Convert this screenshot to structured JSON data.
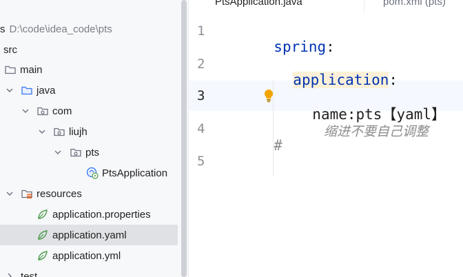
{
  "project_tree": {
    "root": {
      "name": "s",
      "path": "D:\\code\\idea_code\\pts"
    },
    "items": [
      {
        "label": "src"
      },
      {
        "label": "main"
      },
      {
        "label": "java"
      },
      {
        "label": "com"
      },
      {
        "label": "liujh"
      },
      {
        "label": "pts"
      },
      {
        "label": "PtsApplication"
      },
      {
        "label": "resources"
      },
      {
        "label": "application.properties"
      },
      {
        "label": "application.yaml"
      },
      {
        "label": "application.yml"
      },
      {
        "label": "test"
      }
    ]
  },
  "editor": {
    "tabs": [
      {
        "label": "PtsApplication.java"
      },
      {
        "label": "pom.xml (pts)"
      }
    ],
    "line_numbers": [
      "1",
      "2",
      "3",
      "4",
      "5"
    ],
    "lines": {
      "l1_key": "spring",
      "l1_colon": ":",
      "l2_key": "application",
      "l2_colon": ":",
      "l3_text": "name:pts【yaml】",
      "l4_hash": "#",
      "l4_comment": "缩进不要自己调整"
    }
  },
  "colors": {
    "keyword": "#0033b3",
    "selection": "#dfe1e5",
    "current_line": "#f5f8fe",
    "highlight": "#fcf1d8",
    "bulb": "#f2a500"
  },
  "icons": [
    "chevron-down-icon",
    "folder-icon",
    "package-icon",
    "spring-class-icon",
    "resources-folder-icon",
    "spring-leaf-icon",
    "intention-bulb-icon"
  ]
}
